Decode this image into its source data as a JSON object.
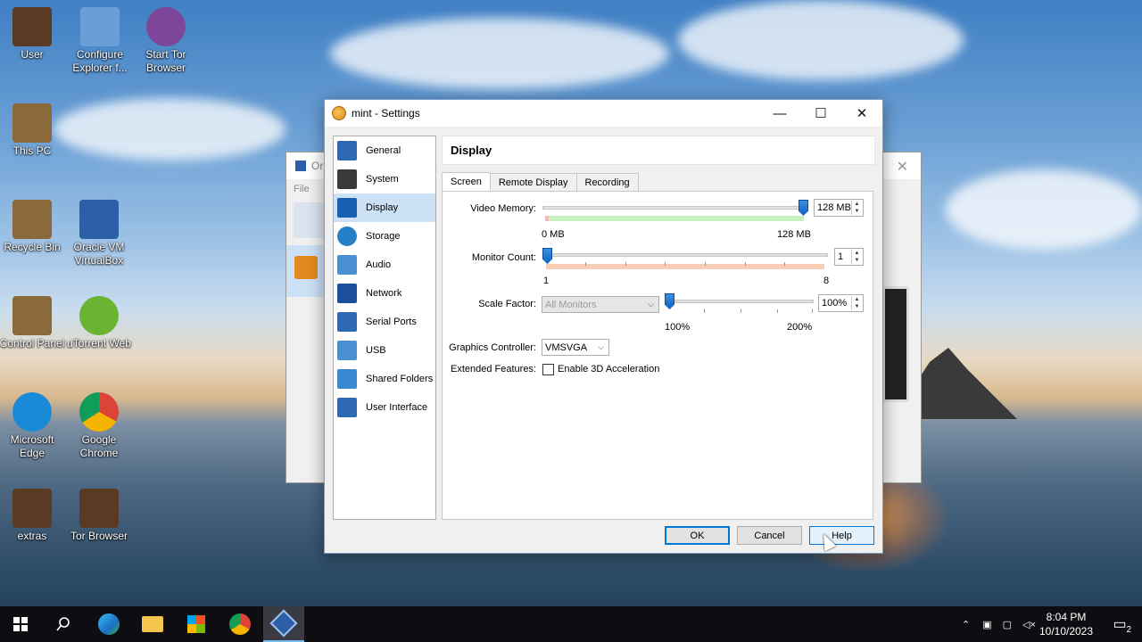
{
  "desktop": {
    "icons": [
      {
        "label": "User",
        "color": "#5a3a22"
      },
      {
        "label": "Configure Explorer f...",
        "color": "#6a9ed8"
      },
      {
        "label": "Start Tor Browser",
        "color": "#7d4698"
      },
      {
        "label": "This PC",
        "color": "#8a6a3a"
      },
      {
        "label": "Recycle Bin",
        "color": "#8a6a3a"
      },
      {
        "label": "Oracle VM VirtualBox",
        "color": "#2d5ea8"
      },
      {
        "label": "Control Panel",
        "color": "#8a6a3a"
      },
      {
        "label": "uTorrent Web",
        "color": "#69b533"
      },
      {
        "label": "Microsoft Edge",
        "color": "#1b8ad6"
      },
      {
        "label": "Google Chrome",
        "color": "#db4437"
      },
      {
        "label": "extras",
        "color": "#5a3a22"
      },
      {
        "label": "Tor Browser",
        "color": "#5a3a22"
      }
    ]
  },
  "bg_window": {
    "title": "Or",
    "menu": "File"
  },
  "dialog": {
    "title": "mint - Settings",
    "minimize": "—",
    "maximize": "☐",
    "close": "✕",
    "sidebar": [
      {
        "label": "General",
        "color": "#2d68b0"
      },
      {
        "label": "System",
        "color": "#3a3a3a"
      },
      {
        "label": "Display",
        "color": "#1b5fb0"
      },
      {
        "label": "Storage",
        "color": "#2580c8"
      },
      {
        "label": "Audio",
        "color": "#4a90d0"
      },
      {
        "label": "Network",
        "color": "#1b4f9a"
      },
      {
        "label": "Serial Ports",
        "color": "#2d68b0"
      },
      {
        "label": "USB",
        "color": "#4a90d0"
      },
      {
        "label": "Shared Folders",
        "color": "#3a88d0"
      },
      {
        "label": "User Interface",
        "color": "#2d68b0"
      }
    ],
    "page_title": "Display",
    "tabs": [
      "Screen",
      "Remote Display",
      "Recording"
    ],
    "video_memory": {
      "label": "Video Memory:",
      "value": "128 MB",
      "min_label": "0 MB",
      "max_label": "128 MB"
    },
    "monitor_count": {
      "label": "Monitor Count:",
      "value": "1",
      "min_label": "1",
      "max_label": "8"
    },
    "scale_factor": {
      "label": "Scale Factor:",
      "combo": "All Monitors",
      "value": "100%",
      "min_label": "100%",
      "max_label": "200%"
    },
    "graphics_controller": {
      "label": "Graphics Controller:",
      "value": "VMSVGA"
    },
    "extended_features": {
      "label": "Extended Features:",
      "checkbox_label": "Enable 3D Acceleration"
    },
    "buttons": {
      "ok": "OK",
      "cancel": "Cancel",
      "help": "Help"
    }
  },
  "taskbar": {
    "time": "8:04 PM",
    "date": "10/10/2023",
    "notification_count": "2"
  }
}
